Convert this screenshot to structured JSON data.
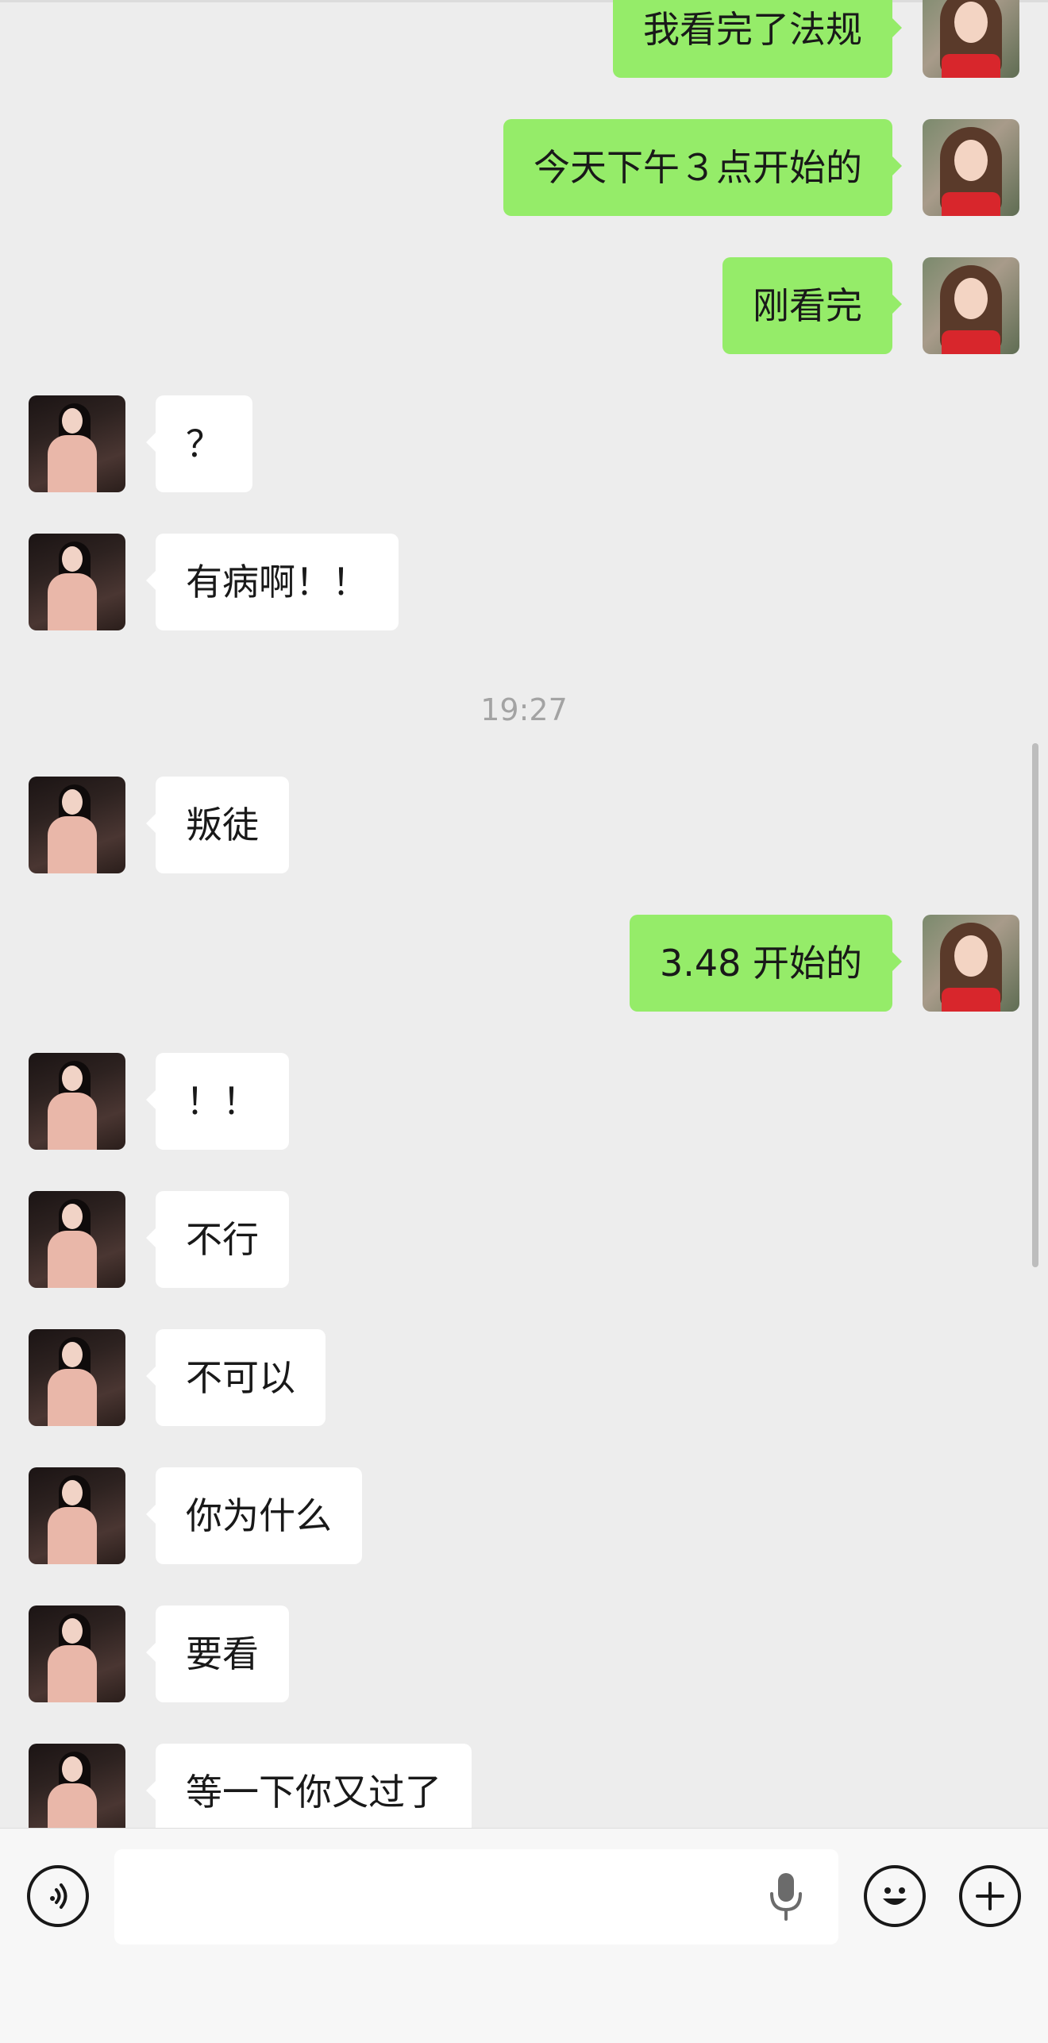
{
  "chat": {
    "timestamp": "19:27",
    "messages_top": [
      {
        "side": "outgoing",
        "text": "我看完了法规"
      },
      {
        "side": "outgoing",
        "text": "今天下午３点开始的"
      },
      {
        "side": "outgoing",
        "text": "刚看完"
      },
      {
        "side": "incoming",
        "text": "？"
      },
      {
        "side": "incoming",
        "text": "有病啊！！"
      }
    ],
    "messages_bottom": [
      {
        "side": "incoming",
        "text": "叛徒"
      },
      {
        "side": "outgoing",
        "text": "3.48 开始的"
      },
      {
        "side": "incoming",
        "text": "！！"
      },
      {
        "side": "incoming",
        "text": "不行"
      },
      {
        "side": "incoming",
        "text": "不可以"
      },
      {
        "side": "incoming",
        "text": "你为什么"
      },
      {
        "side": "incoming",
        "text": "要看"
      },
      {
        "side": "incoming",
        "text": "等一下你又过了"
      }
    ]
  },
  "input_bar": {
    "voice_icon": "voice-mode-icon",
    "mic_icon": "microphone-icon",
    "emoji_icon": "emoji-smile-icon",
    "plus_icon": "plus-circle-icon",
    "text_value": ""
  }
}
